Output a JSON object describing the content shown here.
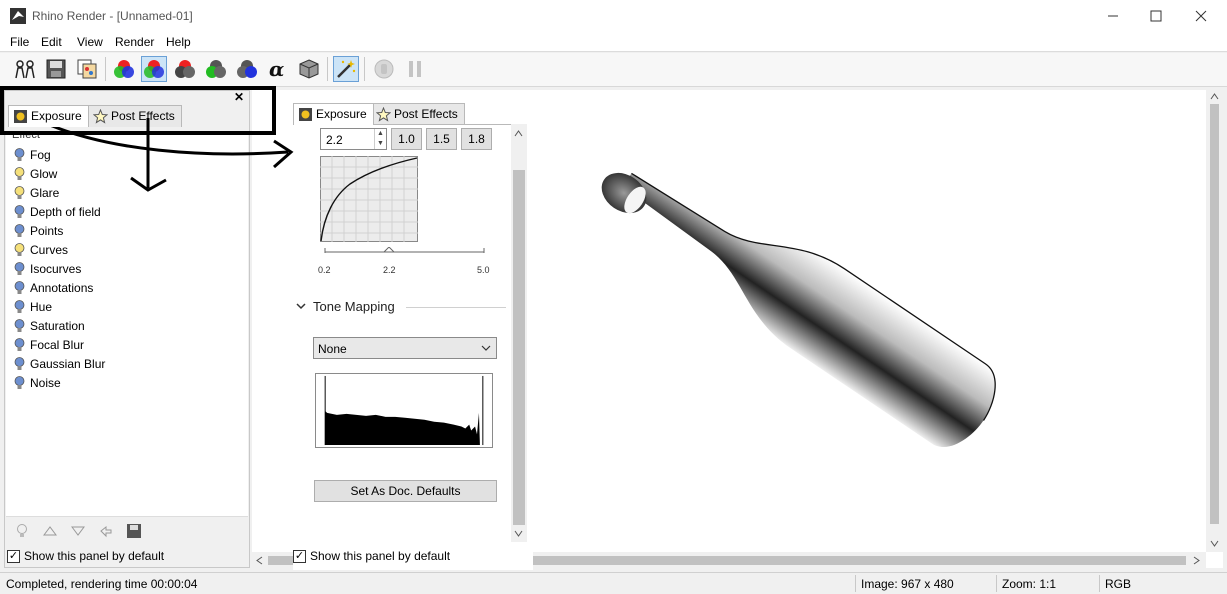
{
  "window": {
    "title": "Rhino Render - [Unnamed-01]",
    "icons": [
      "app-icon",
      "minimize-icon",
      "maximize-icon",
      "close-icon"
    ]
  },
  "menu": {
    "items": [
      "File",
      "Edit",
      "View",
      "Render",
      "Help"
    ]
  },
  "toolbar": {
    "buttons": [
      "compare-icon",
      "save-icon",
      "copy-render-icon",
      "rgb-channels-icon",
      "all-channels-icon",
      "red-channel-icon",
      "green-channel-icon",
      "blue-channel-icon",
      "alpha-channel-icon",
      "monochrome-icon",
      "post-effects-wand-icon",
      "stop-icon",
      "pause-icon"
    ],
    "active": "post-effects-wand-icon"
  },
  "left_panel": {
    "tabs": [
      "Exposure",
      "Post Effects"
    ],
    "selected_tab": "Exposure",
    "list_header": "Effect",
    "effects": [
      {
        "label": "Fog",
        "bulb_on": false
      },
      {
        "label": "Glow",
        "bulb_on": true
      },
      {
        "label": "Glare",
        "bulb_on": true
      },
      {
        "label": "Depth of field",
        "bulb_on": false
      },
      {
        "label": "Points",
        "bulb_on": false
      },
      {
        "label": "Curves",
        "bulb_on": true
      },
      {
        "label": "Isocurves",
        "bulb_on": false
      },
      {
        "label": "Annotations",
        "bulb_on": false
      },
      {
        "label": "Hue",
        "bulb_on": false
      },
      {
        "label": "Saturation",
        "bulb_on": false
      },
      {
        "label": "Focal Blur",
        "bulb_on": false
      },
      {
        "label": "Gaussian Blur",
        "bulb_on": false
      },
      {
        "label": "Noise",
        "bulb_on": false
      }
    ],
    "footer_icons": [
      "bulb-toggle-icon",
      "move-up-icon",
      "move-down-icon",
      "reset-icon",
      "save-settings-icon"
    ],
    "show_default": "Show this panel by default",
    "show_default_checked": true
  },
  "middle_panel": {
    "tabs": [
      "Exposure",
      "Post Effects"
    ],
    "selected_tab": "Exposure",
    "gamma_value": "2.2",
    "presets": [
      "1.0",
      "1.5",
      "1.8"
    ],
    "slider": {
      "min_label": "0.2",
      "mid_label": "2.2",
      "max_label": "5.0",
      "value": 2.2,
      "min": 0.2,
      "max": 5.0
    },
    "tone_mapping_label": "Tone Mapping",
    "tone_mapping_value": "None",
    "set_defaults_label": "Set As Doc. Defaults",
    "show_default": "Show this panel by default",
    "show_default_checked": true
  },
  "status": {
    "message": "Completed, rendering time 00:00:04",
    "image_size": "Image: 967 x 480",
    "zoom": "Zoom: 1:1",
    "channel": "RGB"
  },
  "colors": {
    "bulb_on": "#f5e07a",
    "bulb_off": "#6d8fcf",
    "annotation": "#000000"
  }
}
